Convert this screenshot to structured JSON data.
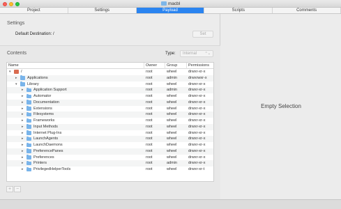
{
  "window": {
    "title": "macbl"
  },
  "tabs": [
    {
      "label": "Project",
      "active": false
    },
    {
      "label": "Settings",
      "active": false
    },
    {
      "label": "Payload",
      "active": true
    },
    {
      "label": "Scripts",
      "active": false
    },
    {
      "label": "Comments",
      "active": false
    }
  ],
  "settings": {
    "heading": "Settings",
    "dest_label": "Default Destination:",
    "dest_value": "/",
    "set_button": "Set"
  },
  "contents": {
    "heading": "Contents",
    "type_label": "Type:",
    "type_value": "Internal"
  },
  "table": {
    "headers": {
      "name": "Name",
      "owner": "Owner",
      "group": "Group",
      "permissions": "Permissions"
    },
    "rows": [
      {
        "name": "/",
        "owner": "root",
        "group": "wheel",
        "perm": "drwxr-xr-x",
        "depth": 0,
        "expanded": true,
        "icon": "disk"
      },
      {
        "name": "Applications",
        "owner": "root",
        "group": "admin",
        "perm": "drwxrwxr-x",
        "depth": 1,
        "expanded": false,
        "icon": "folder"
      },
      {
        "name": "Library",
        "owner": "root",
        "group": "wheel",
        "perm": "drwxr-xr-x",
        "depth": 1,
        "expanded": true,
        "icon": "folder"
      },
      {
        "name": "Application Support",
        "owner": "root",
        "group": "admin",
        "perm": "drwxr-xr-x",
        "depth": 2,
        "expanded": false,
        "icon": "folder"
      },
      {
        "name": "Automator",
        "owner": "root",
        "group": "wheel",
        "perm": "drwxr-xr-x",
        "depth": 2,
        "expanded": false,
        "icon": "folder"
      },
      {
        "name": "Documentation",
        "owner": "root",
        "group": "wheel",
        "perm": "drwxr-xr-x",
        "depth": 2,
        "expanded": false,
        "icon": "folder"
      },
      {
        "name": "Extensions",
        "owner": "root",
        "group": "wheel",
        "perm": "drwxr-xr-x",
        "depth": 2,
        "expanded": false,
        "icon": "folder"
      },
      {
        "name": "Filesystems",
        "owner": "root",
        "group": "wheel",
        "perm": "drwxr-xr-x",
        "depth": 2,
        "expanded": false,
        "icon": "folder"
      },
      {
        "name": "Frameworks",
        "owner": "root",
        "group": "wheel",
        "perm": "drwxr-xr-x",
        "depth": 2,
        "expanded": false,
        "icon": "folder"
      },
      {
        "name": "Input Methods",
        "owner": "root",
        "group": "wheel",
        "perm": "drwxr-xr-x",
        "depth": 2,
        "expanded": false,
        "icon": "folder"
      },
      {
        "name": "Internet Plug-Ins",
        "owner": "root",
        "group": "wheel",
        "perm": "drwxr-xr-x",
        "depth": 2,
        "expanded": false,
        "icon": "folder"
      },
      {
        "name": "LaunchAgents",
        "owner": "root",
        "group": "wheel",
        "perm": "drwxr-xr-x",
        "depth": 2,
        "expanded": false,
        "icon": "folder"
      },
      {
        "name": "LaunchDaemons",
        "owner": "root",
        "group": "wheel",
        "perm": "drwxr-xr-x",
        "depth": 2,
        "expanded": false,
        "icon": "folder"
      },
      {
        "name": "PreferencePanes",
        "owner": "root",
        "group": "wheel",
        "perm": "drwxr-xr-x",
        "depth": 2,
        "expanded": false,
        "icon": "folder"
      },
      {
        "name": "Preferences",
        "owner": "root",
        "group": "wheel",
        "perm": "drwxr-xr-x",
        "depth": 2,
        "expanded": false,
        "icon": "folder"
      },
      {
        "name": "Printers",
        "owner": "root",
        "group": "admin",
        "perm": "drwxr-xr-x",
        "depth": 2,
        "expanded": false,
        "icon": "folder"
      },
      {
        "name": "PrivilegedHelperTools",
        "owner": "root",
        "group": "wheel",
        "perm": "drwxr-xr-t",
        "depth": 2,
        "expanded": false,
        "icon": "folder"
      }
    ]
  },
  "buttons": {
    "add": "+",
    "remove": "−"
  },
  "inspector": {
    "empty_text": "Empty Selection"
  },
  "colors": {
    "accent": "#2a84f0",
    "folder": "#79b4ea"
  }
}
